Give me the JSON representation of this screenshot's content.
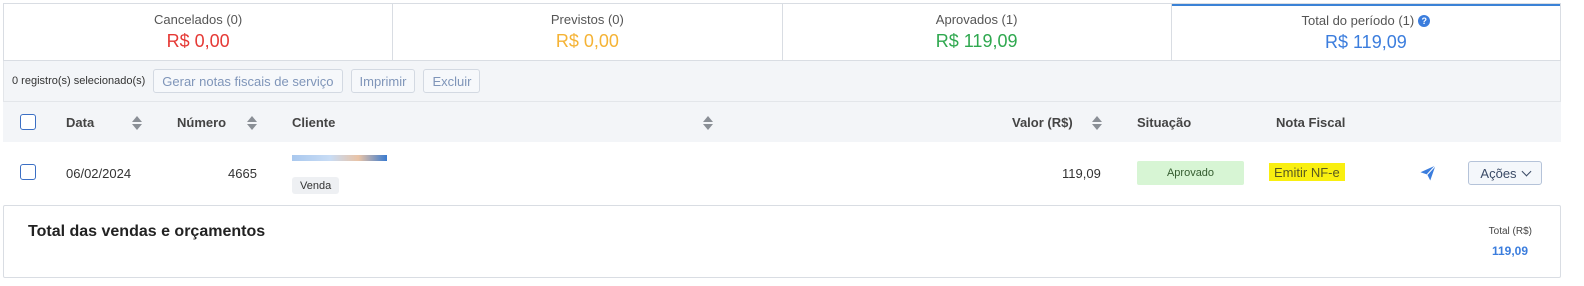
{
  "summary": {
    "cancelados": {
      "label": "Cancelados (0)",
      "value": "R$ 0,00",
      "color": "#e53935"
    },
    "previstos": {
      "label": "Previstos (0)",
      "value": "R$ 0,00",
      "color": "#f5b335"
    },
    "aprovados": {
      "label": "Aprovados (1)",
      "value": "R$ 119,09",
      "color": "#2fa84f"
    },
    "total": {
      "label": "Total do período (1)",
      "value": "R$ 119,09",
      "color": "#3b7ddd",
      "help_icon": "question-circle-icon"
    }
  },
  "actions": {
    "selected_count": "0 registro(s) selecionado(s)",
    "gerar_notas": "Gerar notas fiscais de serviço",
    "imprimir": "Imprimir",
    "excluir": "Excluir"
  },
  "table": {
    "columns": {
      "data": "Data",
      "numero": "Número",
      "cliente": "Cliente",
      "valor": "Valor (R$)",
      "situacao": "Situação",
      "nota_fiscal": "Nota Fiscal"
    },
    "rows": [
      {
        "data": "06/02/2024",
        "numero": "4665",
        "cliente_tag": "Venda",
        "valor": "119,09",
        "situacao": "Aprovado",
        "nota_fiscal": "Emitir NF-e",
        "acoes": "Ações"
      }
    ]
  },
  "footer": {
    "title": "Total das vendas e orçamentos",
    "total_label": "Total (R$)",
    "total_value": "119,09"
  }
}
